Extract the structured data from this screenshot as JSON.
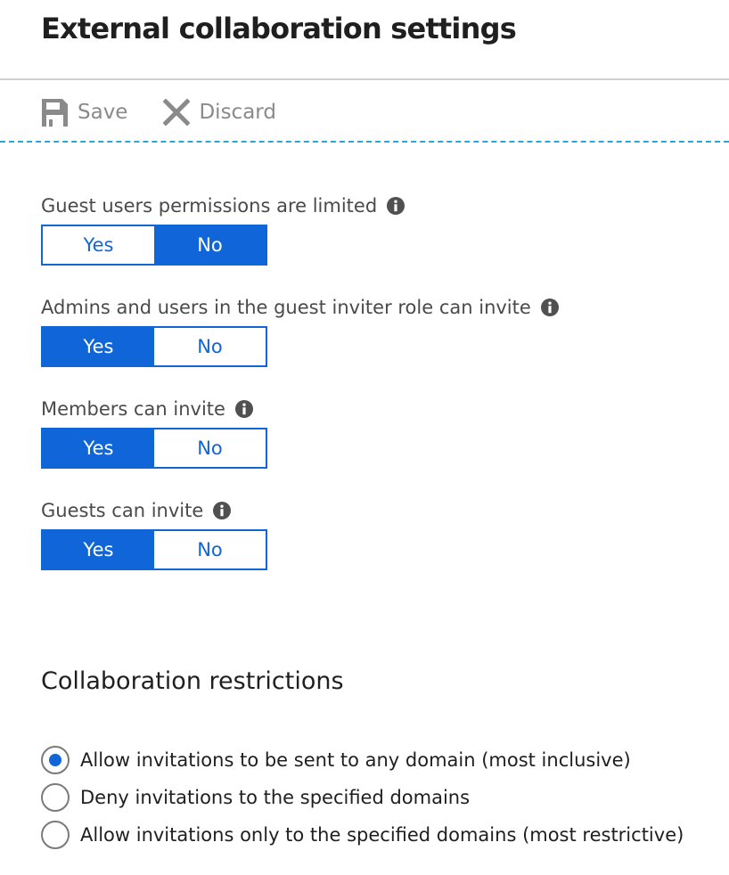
{
  "page": {
    "title": "External collaboration settings"
  },
  "toolbar": {
    "save_label": "Save",
    "discard_label": "Discard",
    "save_icon": "save-icon",
    "discard_icon": "close-icon"
  },
  "colors": {
    "accent": "#1066d8",
    "separator": "#2aa7da",
    "disabled_text": "#8a8a8a"
  },
  "settings": [
    {
      "label": "Guest users permissions are limited",
      "yes_label": "Yes",
      "no_label": "No",
      "selected": "No",
      "info_icon": "info-icon"
    },
    {
      "label": "Admins and users in the guest inviter role can invite",
      "yes_label": "Yes",
      "no_label": "No",
      "selected": "Yes",
      "info_icon": "info-icon"
    },
    {
      "label": "Members can invite",
      "yes_label": "Yes",
      "no_label": "No",
      "selected": "Yes",
      "info_icon": "info-icon"
    },
    {
      "label": "Guests can invite",
      "yes_label": "Yes",
      "no_label": "No",
      "selected": "Yes",
      "info_icon": "info-icon"
    }
  ],
  "restrictions": {
    "title": "Collaboration restrictions",
    "options": [
      {
        "label": "Allow invitations to be sent to any domain (most inclusive)",
        "selected": true
      },
      {
        "label": "Deny invitations to the specified domains",
        "selected": false
      },
      {
        "label": "Allow invitations only to the specified domains (most restrictive)",
        "selected": false
      }
    ]
  }
}
